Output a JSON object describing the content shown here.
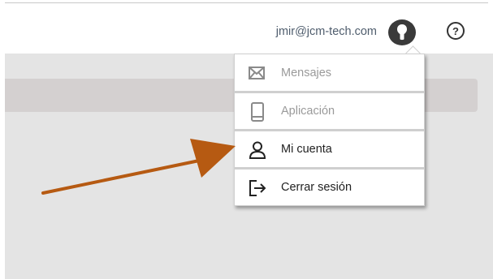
{
  "header": {
    "user_email": "jmir@jcm-tech.com",
    "avatar_icon": "user-avatar-icon",
    "help_label": "?",
    "help_icon": "help-circle-icon"
  },
  "user_menu": {
    "items": [
      {
        "label": "Mensajes",
        "icon": "envelope-icon",
        "enabled": false
      },
      {
        "label": "Aplicación",
        "icon": "mobile-phone-icon",
        "enabled": false
      },
      {
        "label": "Mi cuenta",
        "icon": "user-icon",
        "enabled": true
      },
      {
        "label": "Cerrar sesión",
        "icon": "logout-icon",
        "enabled": true
      }
    ]
  },
  "annotation": {
    "arrow_color": "#b65a12",
    "points_to": "Mi cuenta"
  },
  "colors": {
    "background": "#e4e4e4",
    "bar": "#d4d0d0",
    "email_text": "#4f5d6d"
  }
}
